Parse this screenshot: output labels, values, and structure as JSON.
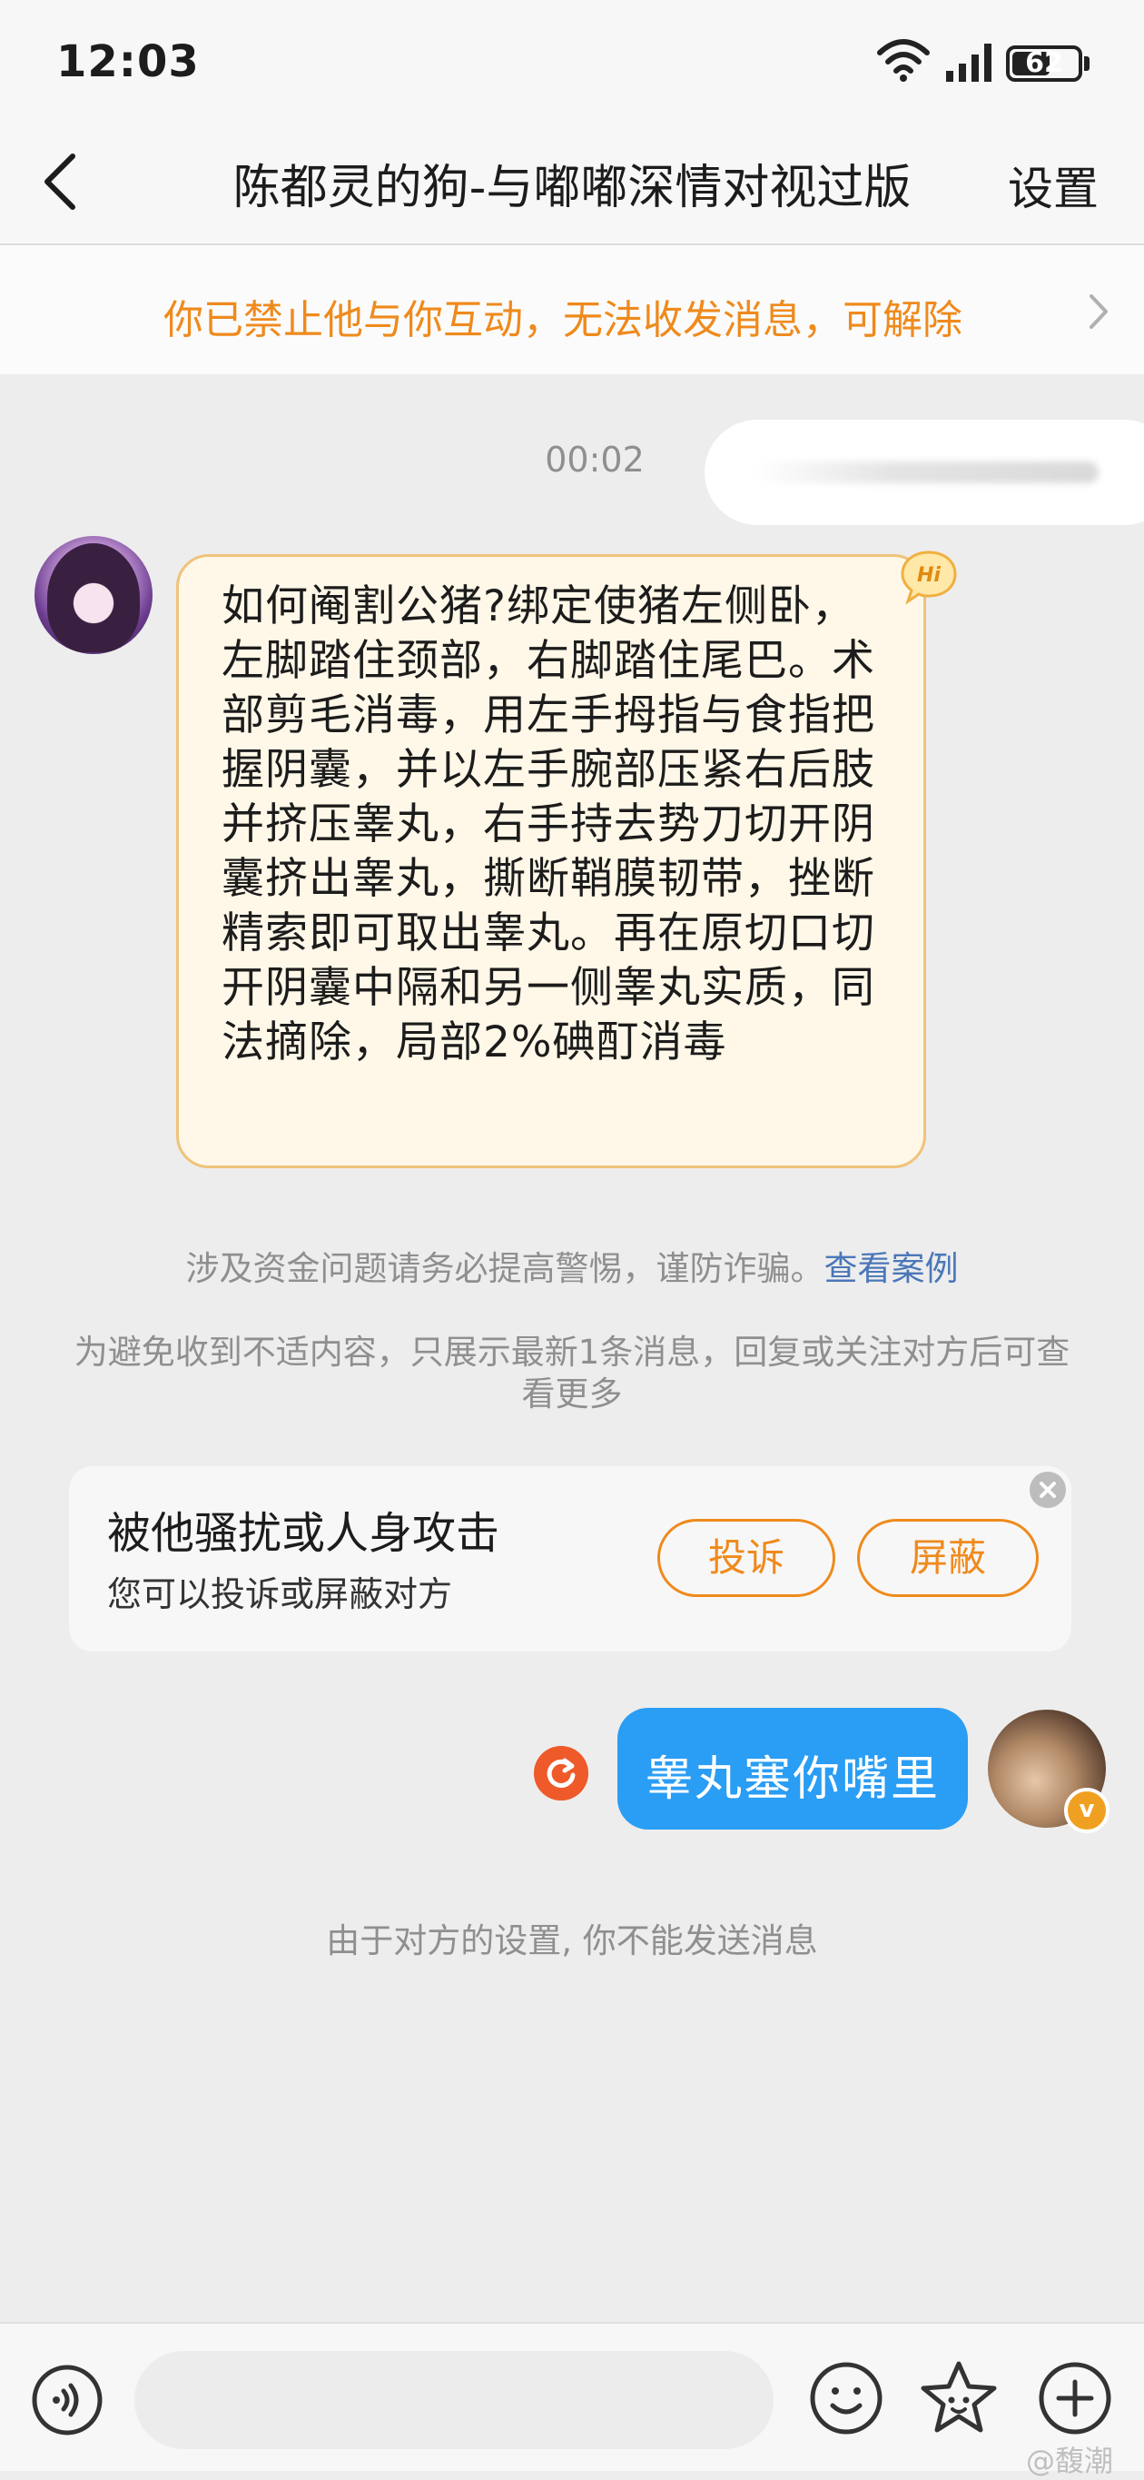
{
  "status_bar": {
    "time": "12:03",
    "battery": "62",
    "battery_level": 0.62
  },
  "header": {
    "title": "陈都灵的狗-与嘟嘟深情对视过版",
    "settings_label": "设置"
  },
  "banner": {
    "text": "你已禁止他与你互动，无法收发消息，可解除"
  },
  "chat": {
    "timestamp": "00:02",
    "incoming_message": "如何阉割公猪?绑定使猪左侧卧，左脚踏住颈部，右脚踏住尾巴。术部剪毛消毒，用左手拇指与食指把握阴囊，并以左手腕部压紧右后肢并挤压睾丸，右手持去势刀切开阴囊挤出睾丸，撕断鞘膜韧带，挫断精索即可取出睾丸。再在原切口切开阴囊中隔和另一侧睾丸实质，同法摘除，局部2%碘酊消毒",
    "hi_badge": "Hi",
    "outgoing_message": "睾丸塞你嘴里",
    "verified_badge": "v"
  },
  "notices": {
    "fraud_warning": "涉及资金问题请务必提高警惕，谨防诈骗。",
    "fraud_link": "查看案例",
    "limit_notice": "为避免收到不适内容，只展示最新1条消息，回复或关注对方后可查看更多",
    "cannot_send": "由于对方的设置, 你不能发送消息"
  },
  "report_card": {
    "title": "被他骚扰或人身攻击",
    "subtitle": "您可以投诉或屏蔽对方",
    "report_label": "投诉",
    "block_label": "屏蔽"
  },
  "watermark": "@馥潮",
  "icons": [
    "back-icon",
    "chevron-right-icon",
    "close-icon",
    "resend-icon",
    "voice-icon",
    "emoji-icon",
    "sticker-icon",
    "plus-icon",
    "wifi-icon",
    "signal-icon"
  ],
  "colors": {
    "accent": "#ef8a1c",
    "bubble_blue": "#2a9df4",
    "link": "#4a77b8",
    "resend": "#ee5a2a"
  }
}
